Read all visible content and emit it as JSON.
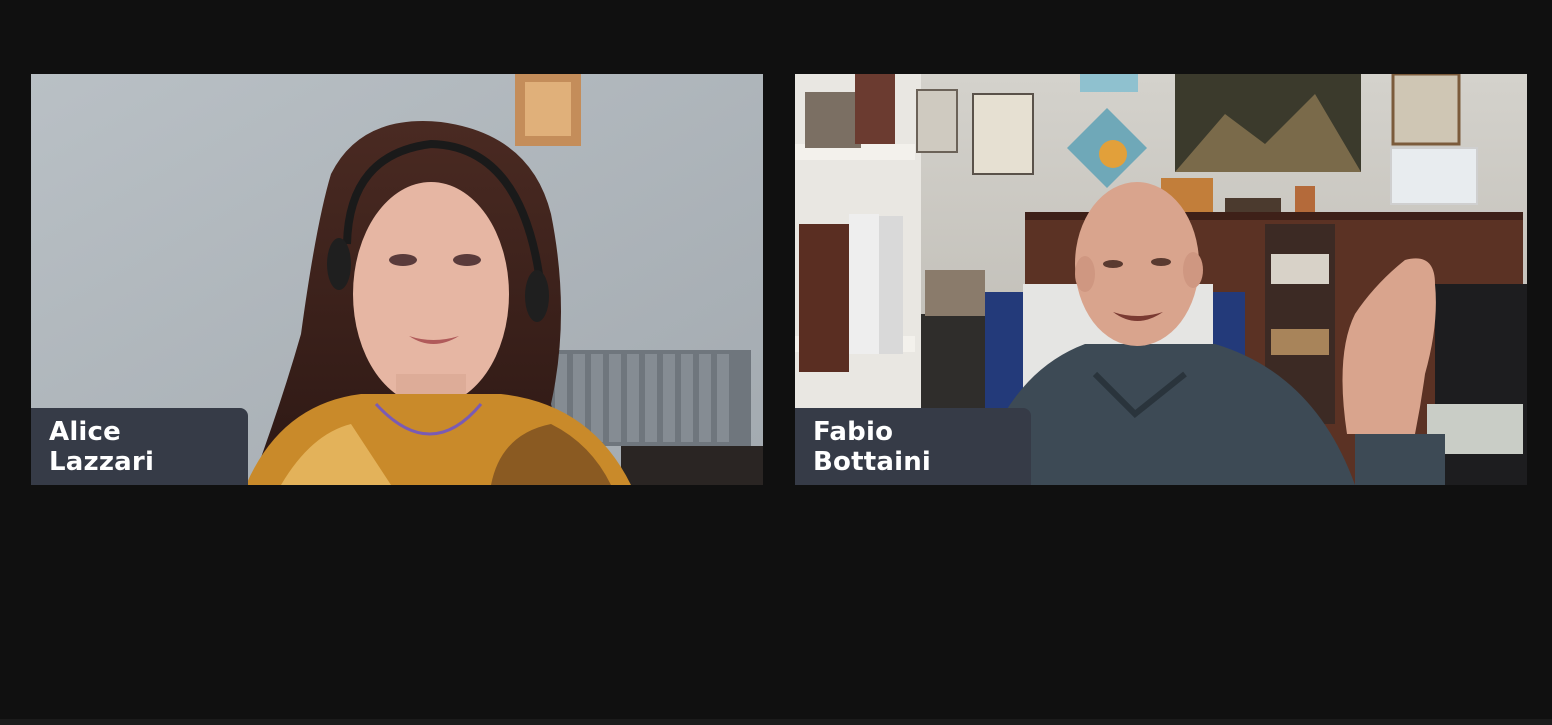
{
  "participants": [
    {
      "name": "Alice Lazzari",
      "camera": "on"
    },
    {
      "name": "Fabio Bottaini",
      "camera": "on"
    }
  ],
  "colors": {
    "background": "#101010",
    "name_tag_bg": "#363b47",
    "name_tag_text": "#ffffff"
  }
}
